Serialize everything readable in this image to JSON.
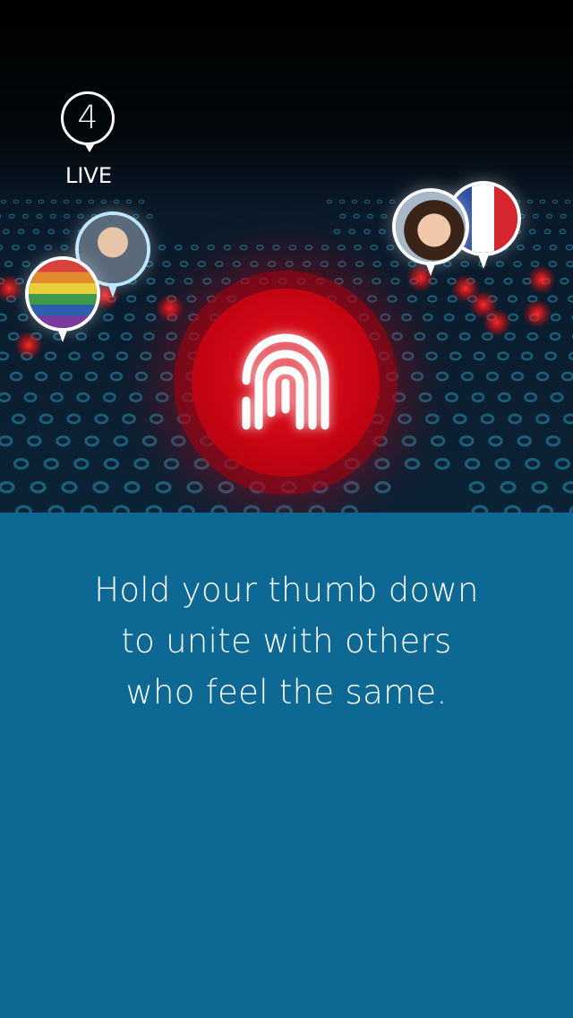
{
  "live_counter": {
    "count": "4",
    "label": "LIVE"
  },
  "instruction": {
    "line1": "Hold your thumb down",
    "line2": "to unite with others",
    "line3": "who feel the same."
  },
  "colors": {
    "panel_background": "#0e6894",
    "accent_red": "#d6091a",
    "map_dot": "#1d6a86"
  },
  "icons": {
    "fingerprint": "fingerprint-icon"
  }
}
